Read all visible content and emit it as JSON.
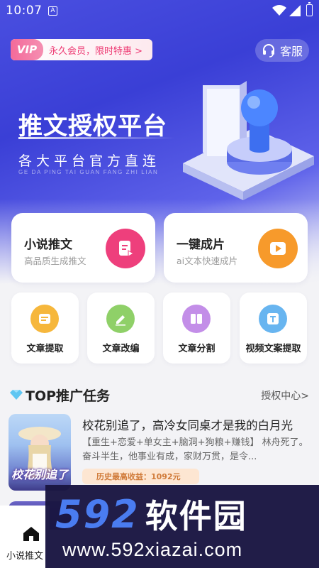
{
  "status_bar": {
    "time": "10:07",
    "notification_glyph": "A"
  },
  "header": {
    "vip_tag": "VIP",
    "vip_offer": "永久会员，限时特惠 >",
    "service_label": "客服"
  },
  "hero": {
    "title": "推文授权平台",
    "subtitle": "各大平台官方直连",
    "pinyin": "GE DA PING TAI GUAN FANG ZHI LIAN"
  },
  "feature_cards": [
    {
      "title": "小说推文",
      "desc": "高品质生成推文",
      "icon": "document-edit-icon",
      "color": "#ee3f7c"
    },
    {
      "title": "一键成片",
      "desc": "ai文本快速成片",
      "icon": "play-icon",
      "color": "#f79a2b"
    }
  ],
  "tools": [
    {
      "label": "文章提取",
      "icon": "text-extract-icon",
      "color": "#f6b73c"
    },
    {
      "label": "文章改编",
      "icon": "pencil-icon",
      "color": "#8fd068"
    },
    {
      "label": "文章分割",
      "icon": "book-split-icon",
      "color": "#c38ee8"
    },
    {
      "label": "视频文案提取",
      "icon": "text-t-icon",
      "color": "#68b5f0"
    }
  ],
  "section": {
    "title": "TOP推广任务",
    "more": "授权中心>"
  },
  "tasks": [
    {
      "title": "校花别追了，高冷女同桌才是我的白月光",
      "desc": "【重生+恋爱+单女主+脑洞+狗粮+赚钱】 林舟死了。 奋斗半生，他事业有成，家财万贯，是令...",
      "earnings": "历史最高收益：1092元",
      "cover_text": "校花别追了"
    }
  ],
  "bottom_nav": {
    "home_label": "小说推文"
  },
  "watermark": {
    "logo_digits": "592",
    "logo_text": "软件园",
    "url": "www.592xiazai.com"
  },
  "colors": {
    "hero_blue": "#3a3fd6",
    "vip_pink": "#ee3b74",
    "earn_orange": "#d07b3a"
  }
}
